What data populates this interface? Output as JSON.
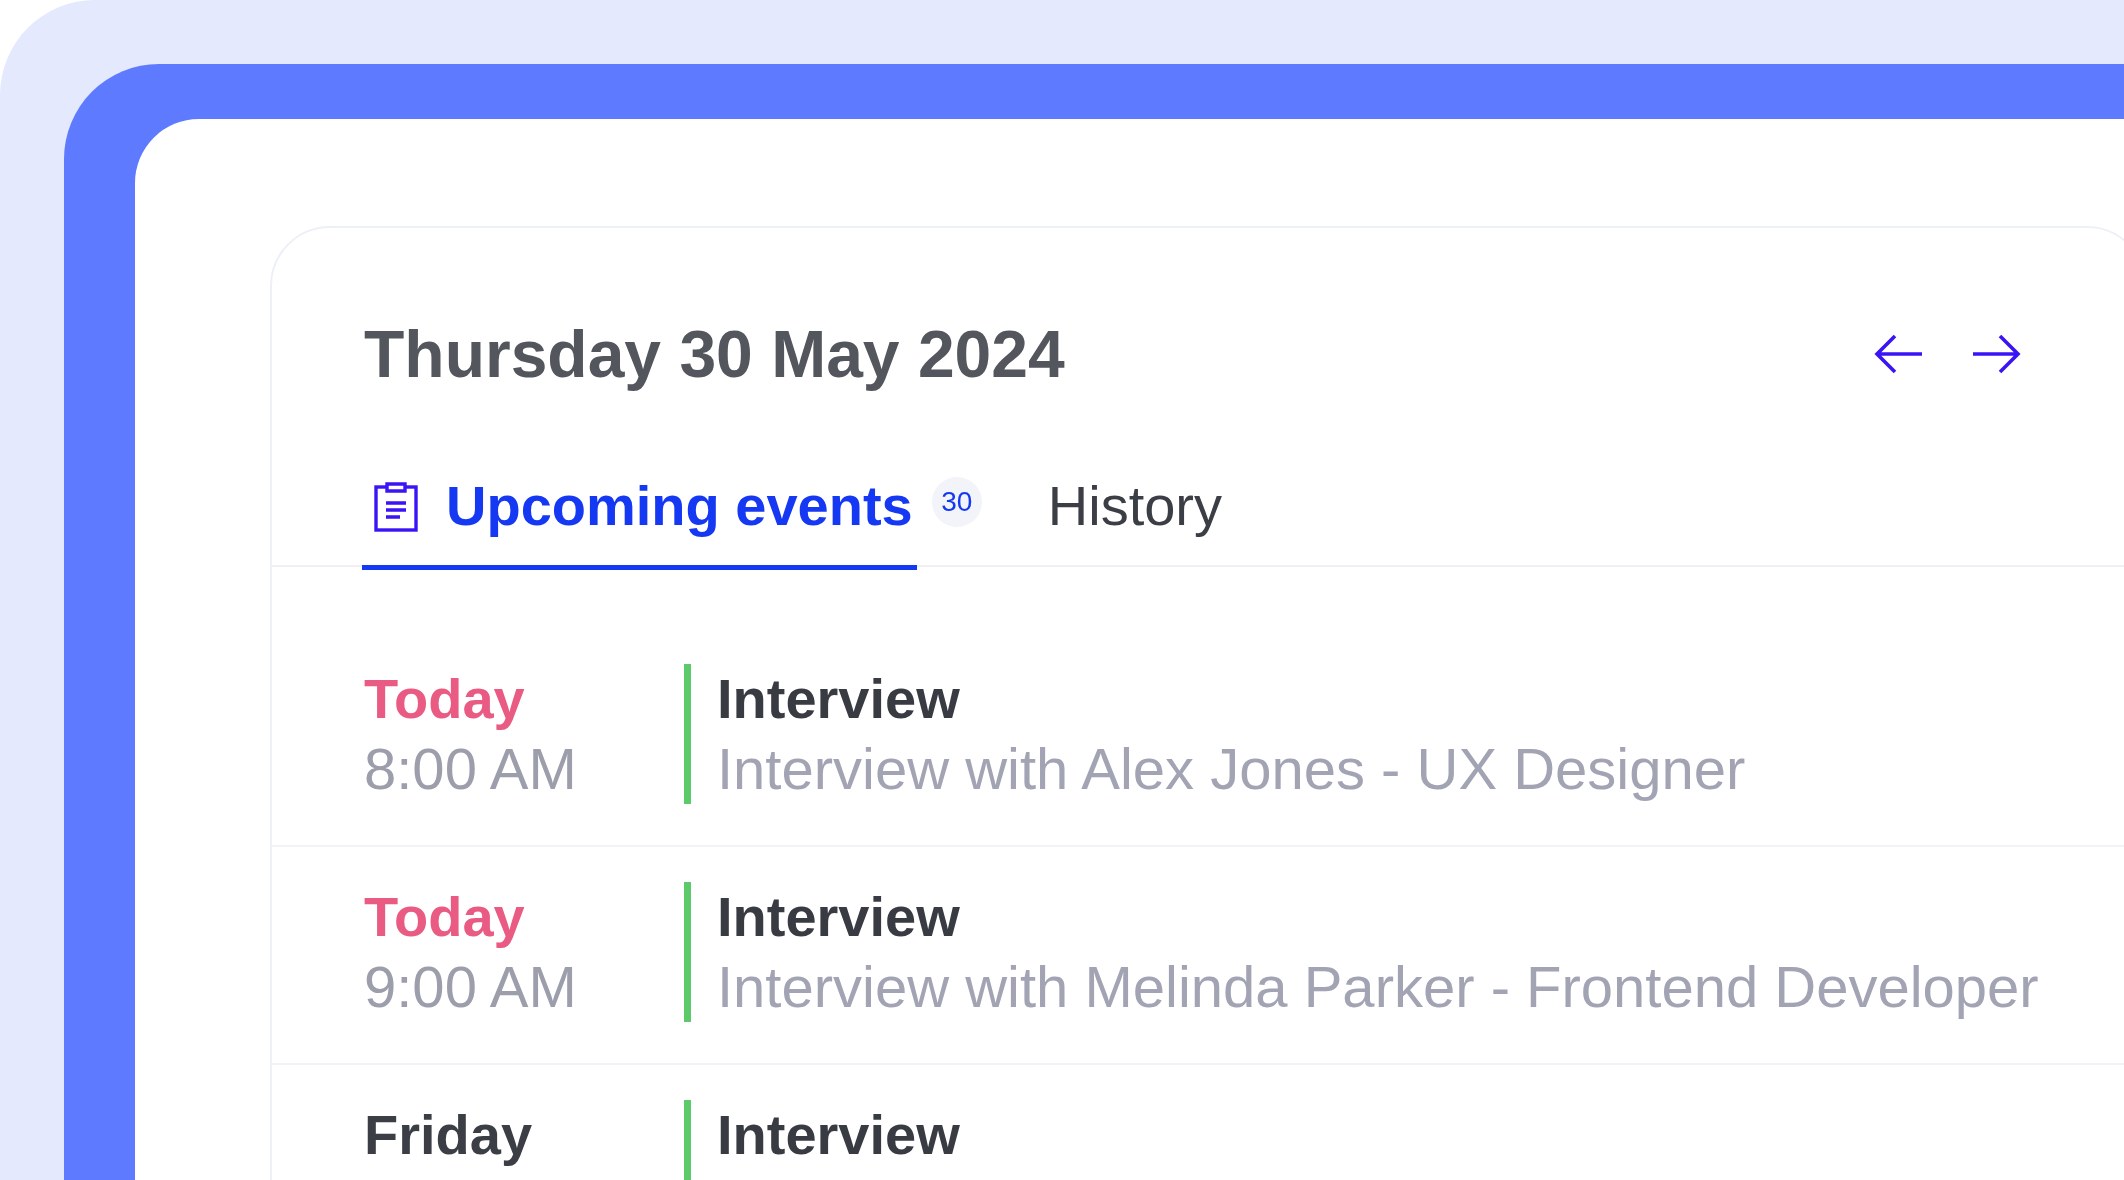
{
  "header": {
    "date": "Thursday 30 May 2024"
  },
  "tabs": [
    {
      "label": "Upcoming events",
      "badge": "30",
      "selected": true
    },
    {
      "label": "History",
      "selected": false
    }
  ],
  "events": [
    {
      "day": "Today",
      "today": true,
      "time": "8:00 AM",
      "title": "Interview",
      "description": "Interview with Alex Jones - UX Designer",
      "color": "#5cc96b"
    },
    {
      "day": "Today",
      "today": true,
      "time": "9:00 AM",
      "title": "Interview",
      "description": "Interview with Melinda Parker - Frontend Developer",
      "color": "#5cc96b"
    },
    {
      "day": "Friday",
      "today": false,
      "title": "Interview",
      "color": "#5cc96b"
    }
  ]
}
